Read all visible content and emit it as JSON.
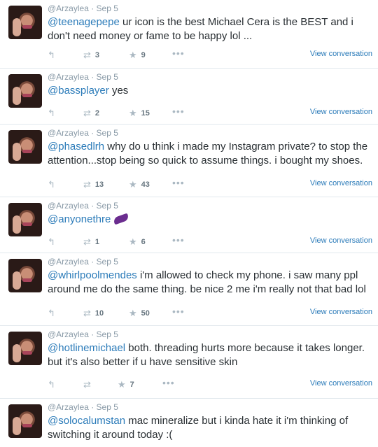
{
  "tweets": [
    {
      "name": "@Arzaylea",
      "date": "Sep 5",
      "header": "@Arzaylea · Sep 5",
      "mention": "@teenagepepe",
      "body": " ur icon is the best Michael Cera is the BEST and i don't need money or fame to be happy lol ...",
      "retweets": "3",
      "favorites": "9",
      "view_label": "View conversation"
    },
    {
      "name": "@Arzaylea",
      "date": "Sep 5",
      "header": "@Arzaylea · Sep 5",
      "mention": "@bassplayer",
      "body": " yes",
      "retweets": "2",
      "favorites": "15",
      "view_label": "View conversation"
    },
    {
      "name": "@Arzaylea",
      "date": "Sep 5",
      "header": "@Arzaylea · Sep 5",
      "mention": "@phasedlrh",
      "body": " why do u think i made my Instagram private? to stop the attention...stop being so quick to assume things. i bought my shoes.",
      "retweets": "13",
      "favorites": "43",
      "view_label": "View conversation"
    },
    {
      "name": "@Arzaylea",
      "date": "Sep 5",
      "header": "@Arzaylea · Sep 5",
      "mention": "@anyonethre",
      "body": "",
      "emoji": "eggplant-emoji",
      "retweets": "1",
      "favorites": "6",
      "view_label": "View conversation"
    },
    {
      "name": "@Arzaylea",
      "date": "Sep 5",
      "header": "@Arzaylea · Sep 5",
      "mention": "@whirlpoolmendes",
      "body": " i'm allowed to check my phone. i saw many ppl around me do the same thing. be nice 2 me i'm really not that bad lol",
      "retweets": "10",
      "favorites": "50",
      "view_label": "View conversation"
    },
    {
      "name": "@Arzaylea",
      "date": "Sep 5",
      "header": "@Arzaylea · Sep 5",
      "mention": "@hotlinemichael",
      "body": " both. threading hurts more because it takes longer. but it's also better if u have sensitive skin",
      "retweets": "",
      "favorites": "7",
      "view_label": "View conversation"
    },
    {
      "name": "@Arzaylea",
      "date": "Sep 5",
      "header": "@Arzaylea · Sep 5",
      "mention": "@solocalumstan",
      "body": " mac mineralize but i kinda hate it i'm thinking of switching it around today :("
    }
  ],
  "colors": {
    "link": "#2b7bb9",
    "meta": "#8899a6",
    "text": "#292f33",
    "icon": "#aab8c2"
  },
  "icons": {
    "reply": "reply-icon",
    "retweet": "retweet-icon",
    "favorite": "star-icon",
    "more": "more-icon"
  }
}
